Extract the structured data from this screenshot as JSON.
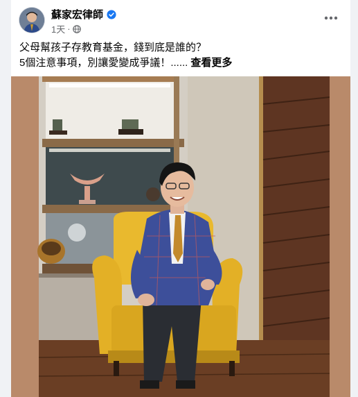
{
  "post": {
    "author": "蘇家宏律師",
    "time": "1天",
    "text_line1": "父母幫孩子存教育基金，錢到底是誰的？",
    "text_line2": "5個注意事項，別讓愛變成爭議！......",
    "see_more": "查看更多"
  },
  "icons": {
    "verified": "verified-badge-icon",
    "audience": "globe-icon",
    "menu": "more-options-icon"
  },
  "colors": {
    "verified": "#1877f2",
    "text": "#050505",
    "secondary": "#65676b"
  }
}
